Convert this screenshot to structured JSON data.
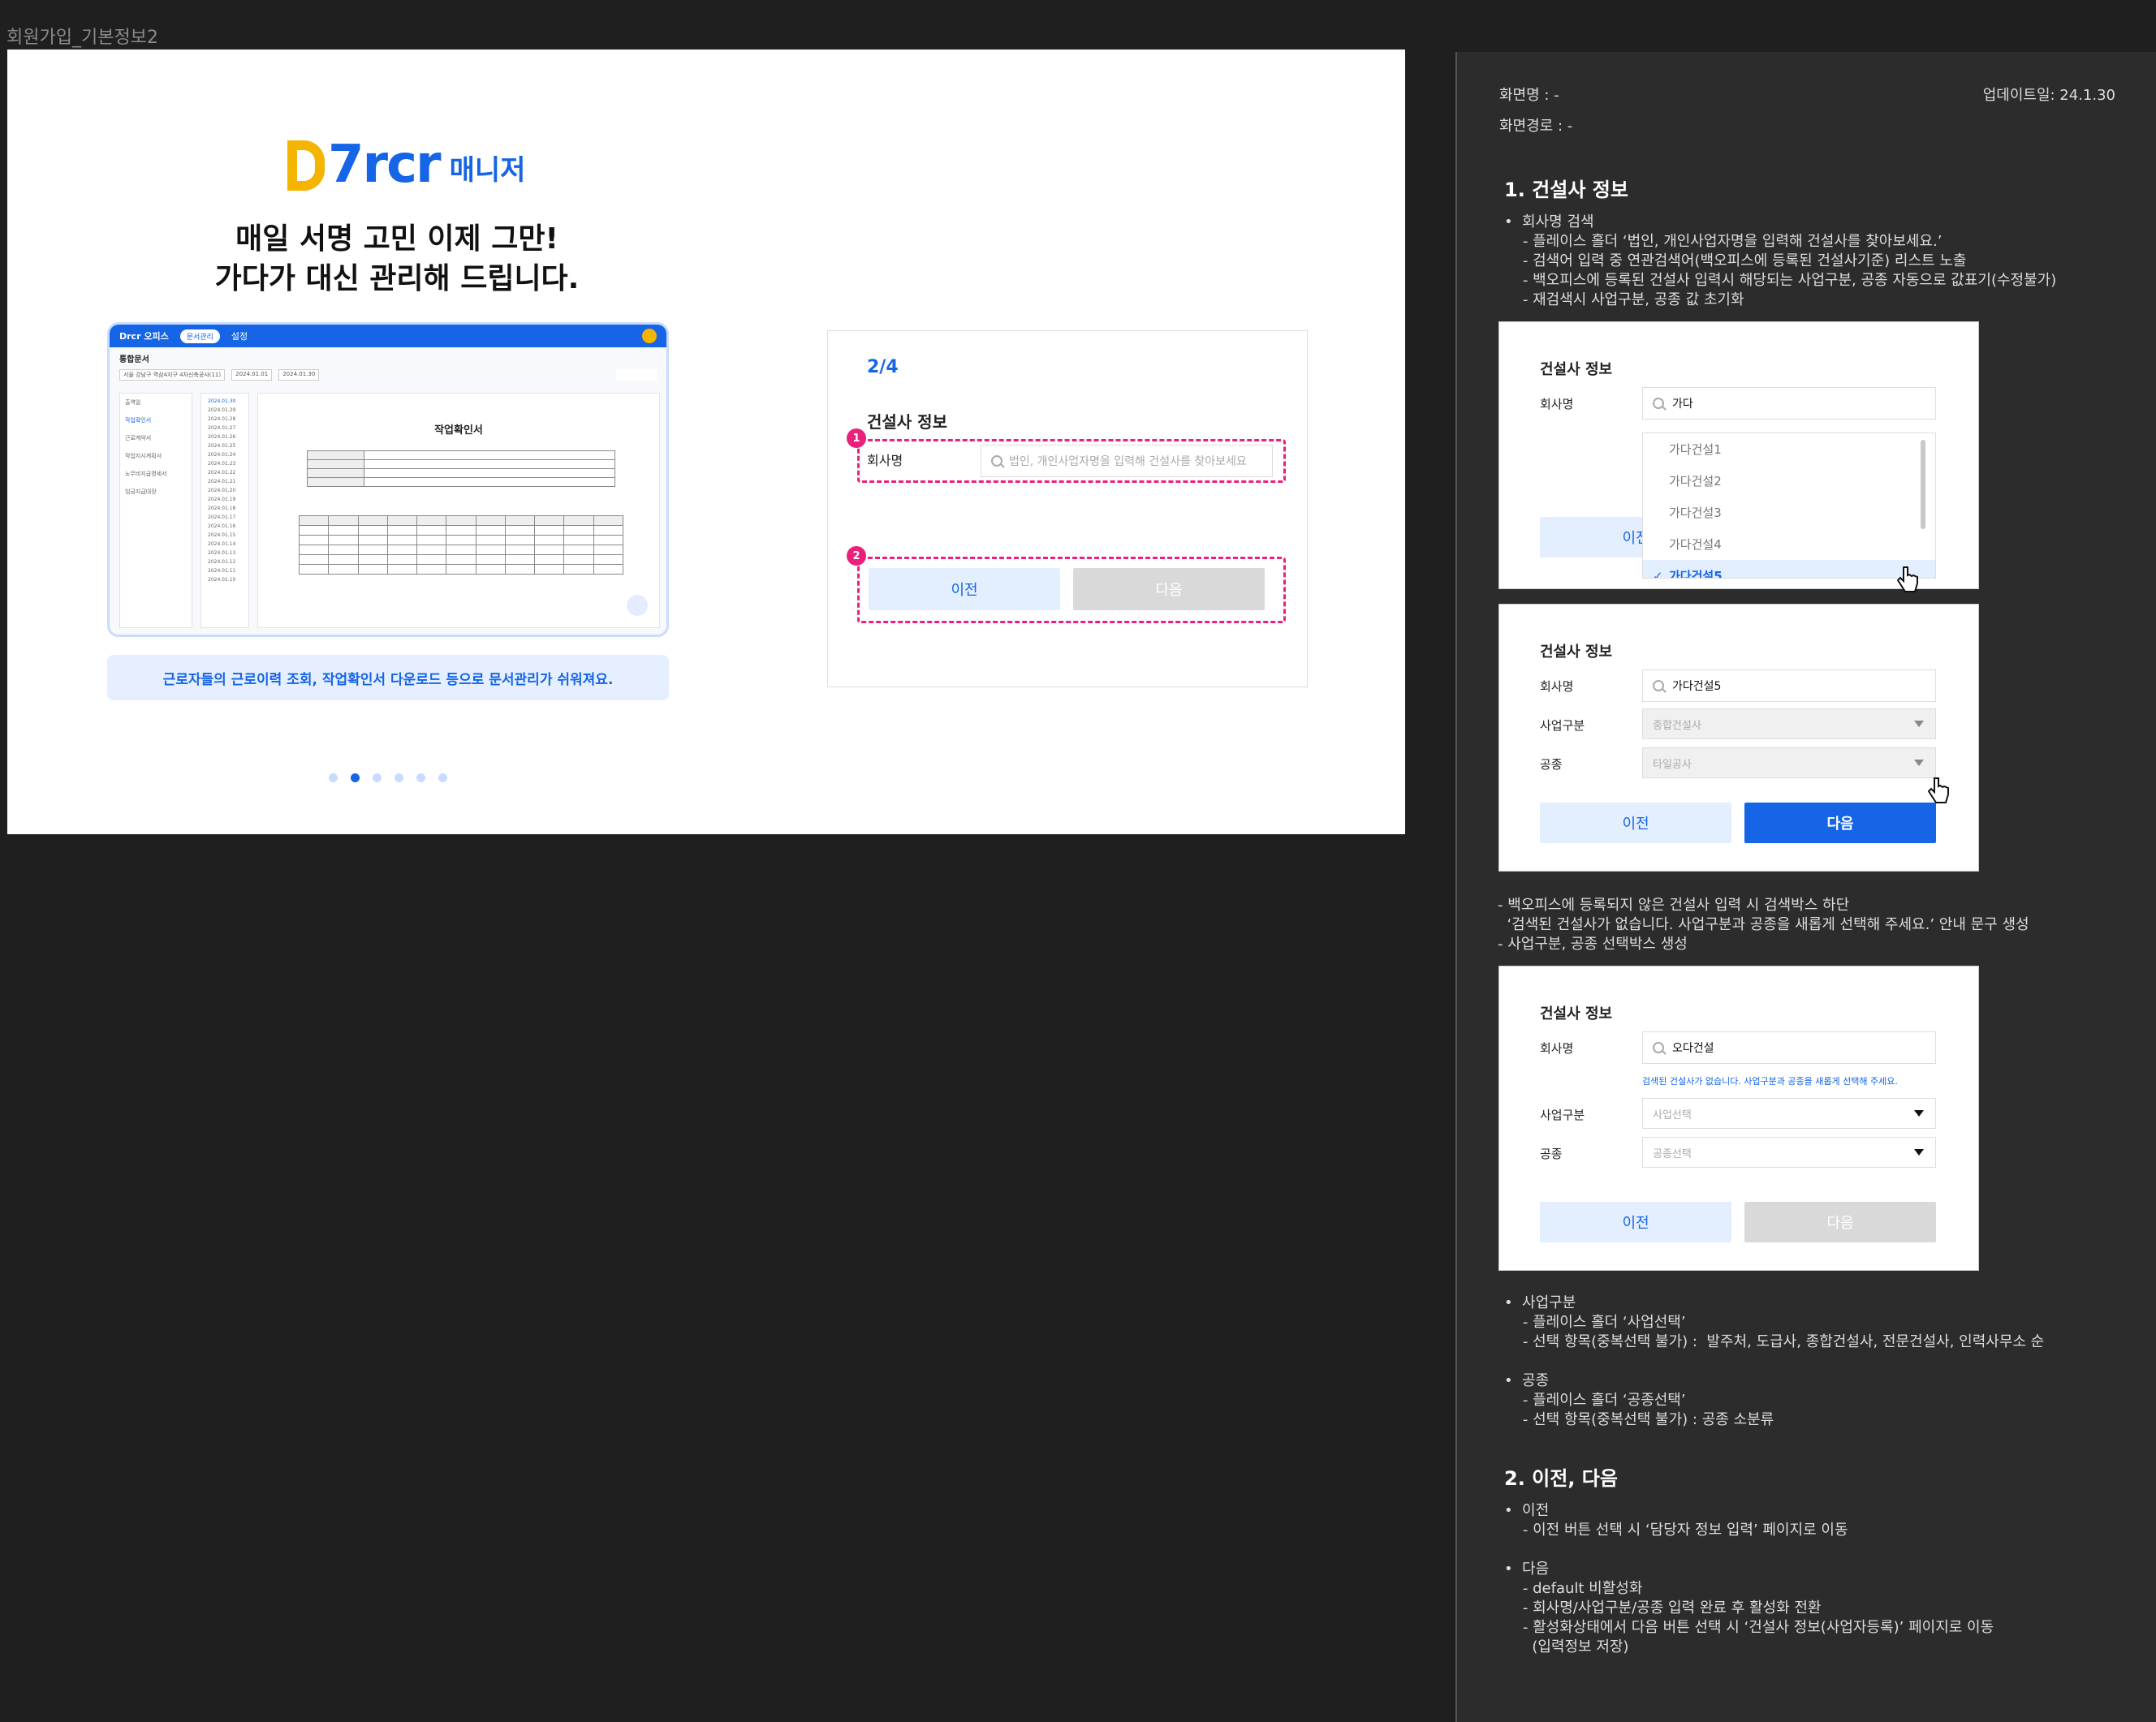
{
  "frame_title": "회원가입_기본정보2",
  "hero": {
    "logo_mark": "7rcr",
    "logo_sub": "매니저",
    "headline_line1": "매일 서명 고민 이제 그만!",
    "headline_line2": "가다가 대신 관리해 드립니다.",
    "caption": "근로자들의  근로이력 조회, 작업확인서 다운로드 등으로 문서관리가 쉬워져요.",
    "slides_total": 6,
    "slide_active": 2
  },
  "mock": {
    "brand": "Drcr 오피스",
    "nav_active": "문서관리",
    "nav_other": "설정",
    "page_title": "통합문서",
    "site_select": "서울 강남구 역삼4지구 4차신축공사(11)",
    "date_from": "2024.01.01",
    "date_to": "2024.01.30",
    "download_btn": "PDF 다운로드",
    "menu": [
      "출역일",
      "작업확인서",
      "근로계약서",
      "작업지시계획서",
      "노무비지급명세서",
      "임금지급대장"
    ],
    "dates": [
      "2024.01.30",
      "2024.01.29",
      "2024.01.28",
      "2024.01.27",
      "2024.01.26",
      "2024.01.25",
      "2024.01.24",
      "2024.01.23",
      "2024.01.22",
      "2024.01.21",
      "2024.01.20",
      "2024.01.19",
      "2024.01.18",
      "2024.01.17",
      "2024.01.16",
      "2024.01.15",
      "2024.01.14",
      "2024.01.13",
      "2024.01.12",
      "2024.01.11",
      "2024.01.10"
    ],
    "doc_title": "작업확인서"
  },
  "form": {
    "step": "2/4",
    "section_title": "건설사 정보",
    "company_label": "회사명",
    "company_placeholder": "법인, 개인사업자명을 입력해 건설사를 찾아보세요",
    "prev": "이전",
    "next": "다음",
    "badge1": "1",
    "badge2": "2"
  },
  "panel": {
    "screen_name": "화면명 : -",
    "screen_path": "화면경로 : -",
    "update_date": "업데이트일: 24.1.30",
    "h1": "1. 건설사 정보",
    "block1": "•  회사명 검색\n    - 플레이스 홀더 ‘법인, 개인사업자명을 입력해 건설사를 찾아보세요.’\n    - 검색어 입력 중 연관검색어(백오피스에 등록된 건설사기준) 리스트 노출\n    - 백오피스에 등록된 건설사 입력시 해당되는 사업구분, 공종 자동으로 값표기(수정불가)\n    - 재검색시 사업구분, 공종 값 초기화",
    "block2": "- 백오피스에 등록되지 않은 건설사 입력 시 검색박스 하단\n  ‘검색된 건설사가 없습니다. 사업구분과 공종을 새롭게 선택해 주세요.’ 안내 문구 생성\n- 사업구분, 공종 선택박스 생성",
    "block3": "•  사업구분\n    - 플레이스 홀더 ‘사업선택’\n    - 선택 항목(중복선택 불가) :  발주처, 도급사, 종합건설사, 전문건설사, 인력사무소 순\n\n•  공종\n    - 플레이스 홀더 ‘공종선택’\n    - 선택 항목(중복선택 불가) : 공종 소분류",
    "h2": "2. 이전, 다음",
    "block4": "•  이전\n    - 이전 버튼 선택 시 ‘담당자 정보 입력’ 페이지로 이동\n\n•  다음\n    - default 비활성화\n    - 회사명/사업구분/공종 입력 완료 후 활성화 전환\n    - 활성화상태에서 다음 버튼 선택 시 ‘건설사 정보(사업자등록)’ 페이지로 이동\n      (입력정보 저장)"
  },
  "example1": {
    "title": "건설사 정보",
    "company_label": "회사명",
    "query": "가다",
    "options": [
      "가다건설1",
      "가다건설2",
      "가다건설3",
      "가다건설4",
      "가다건설5"
    ],
    "selected": "가다건설5",
    "prev": "이전"
  },
  "example2": {
    "title": "건설사 정보",
    "company_label": "회사명",
    "company_value": "가다건설5",
    "biz_label": "사업구분",
    "biz_value": "종합건설사",
    "trade_label": "공종",
    "trade_value": "타일공사",
    "prev": "이전",
    "next": "다음"
  },
  "example3": {
    "title": "건설사 정보",
    "company_label": "회사명",
    "company_value": "오다건설",
    "hint": "검색된 건설사가 없습니다. 사업구분과 공종을 새롭게 선택해 주세요.",
    "biz_label": "사업구분",
    "biz_placeholder": "사업선택",
    "trade_label": "공종",
    "trade_placeholder": "공종선택",
    "prev": "이전",
    "next": "다음"
  }
}
